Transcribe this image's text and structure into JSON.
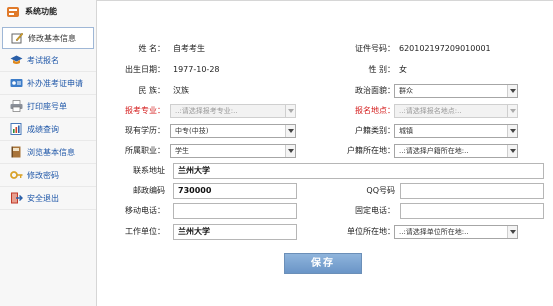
{
  "sidebar": {
    "title": "系统功能",
    "items": [
      {
        "label": "修改基本信息",
        "icon": "edit-icon",
        "active": true
      },
      {
        "label": "考试报名",
        "icon": "graduation-cap-icon"
      },
      {
        "label": "补办准考证申请",
        "icon": "id-card-icon"
      },
      {
        "label": "打印座号单",
        "icon": "printer-icon"
      },
      {
        "label": "成绩查询",
        "icon": "report-icon"
      },
      {
        "label": "浏览基本信息",
        "icon": "book-icon"
      },
      {
        "label": "修改密码",
        "icon": "key-icon"
      },
      {
        "label": "安全退出",
        "icon": "exit-icon"
      }
    ]
  },
  "form": {
    "name_label": "姓 名：",
    "name_value": "自考考生",
    "id_label": "证件号码：",
    "id_value": "620102197209010001",
    "birth_label": "出生日期：",
    "birth_value": "1977-10-28",
    "gender_label": "性 别：",
    "gender_value": "女",
    "ethnic_label": "民 族：",
    "ethnic_value": "汉族",
    "political_label": "政治面貌：",
    "political_value": "群众",
    "major_label": "报考专业：",
    "major_placeholder": "..:请选择报考专业:..",
    "location_label": "报名地点：",
    "location_placeholder": "..:请选择报名地点:..",
    "education_label": "现有学历：",
    "education_value": "中专(中技)",
    "hukou_type_label": "户籍类别：",
    "hukou_type_value": "城镇",
    "occupation_label": "所属职业：",
    "occupation_value": "学生",
    "hukou_place_label": "户籍所在地：",
    "hukou_place_placeholder": "..:请选择户籍所在地:..",
    "address_label": "联系地址",
    "address_value": "兰州大学",
    "postcode_label": "邮政编码",
    "postcode_value": "730000",
    "qq_label": "QQ号码",
    "qq_value": "",
    "mobile_label": "移动电话：",
    "mobile_value": "",
    "phone_label": "固定电话：",
    "phone_value": "",
    "work_label": "工作单位：",
    "work_value": "兰州大学",
    "work_place_label": "单位所在地：",
    "work_place_placeholder": "..:请选择单位所在地:..",
    "save_label": "保存"
  },
  "colors": {
    "required_label": "#d41b1b",
    "link": "#1f57a8",
    "button": "#7aa3d2"
  }
}
